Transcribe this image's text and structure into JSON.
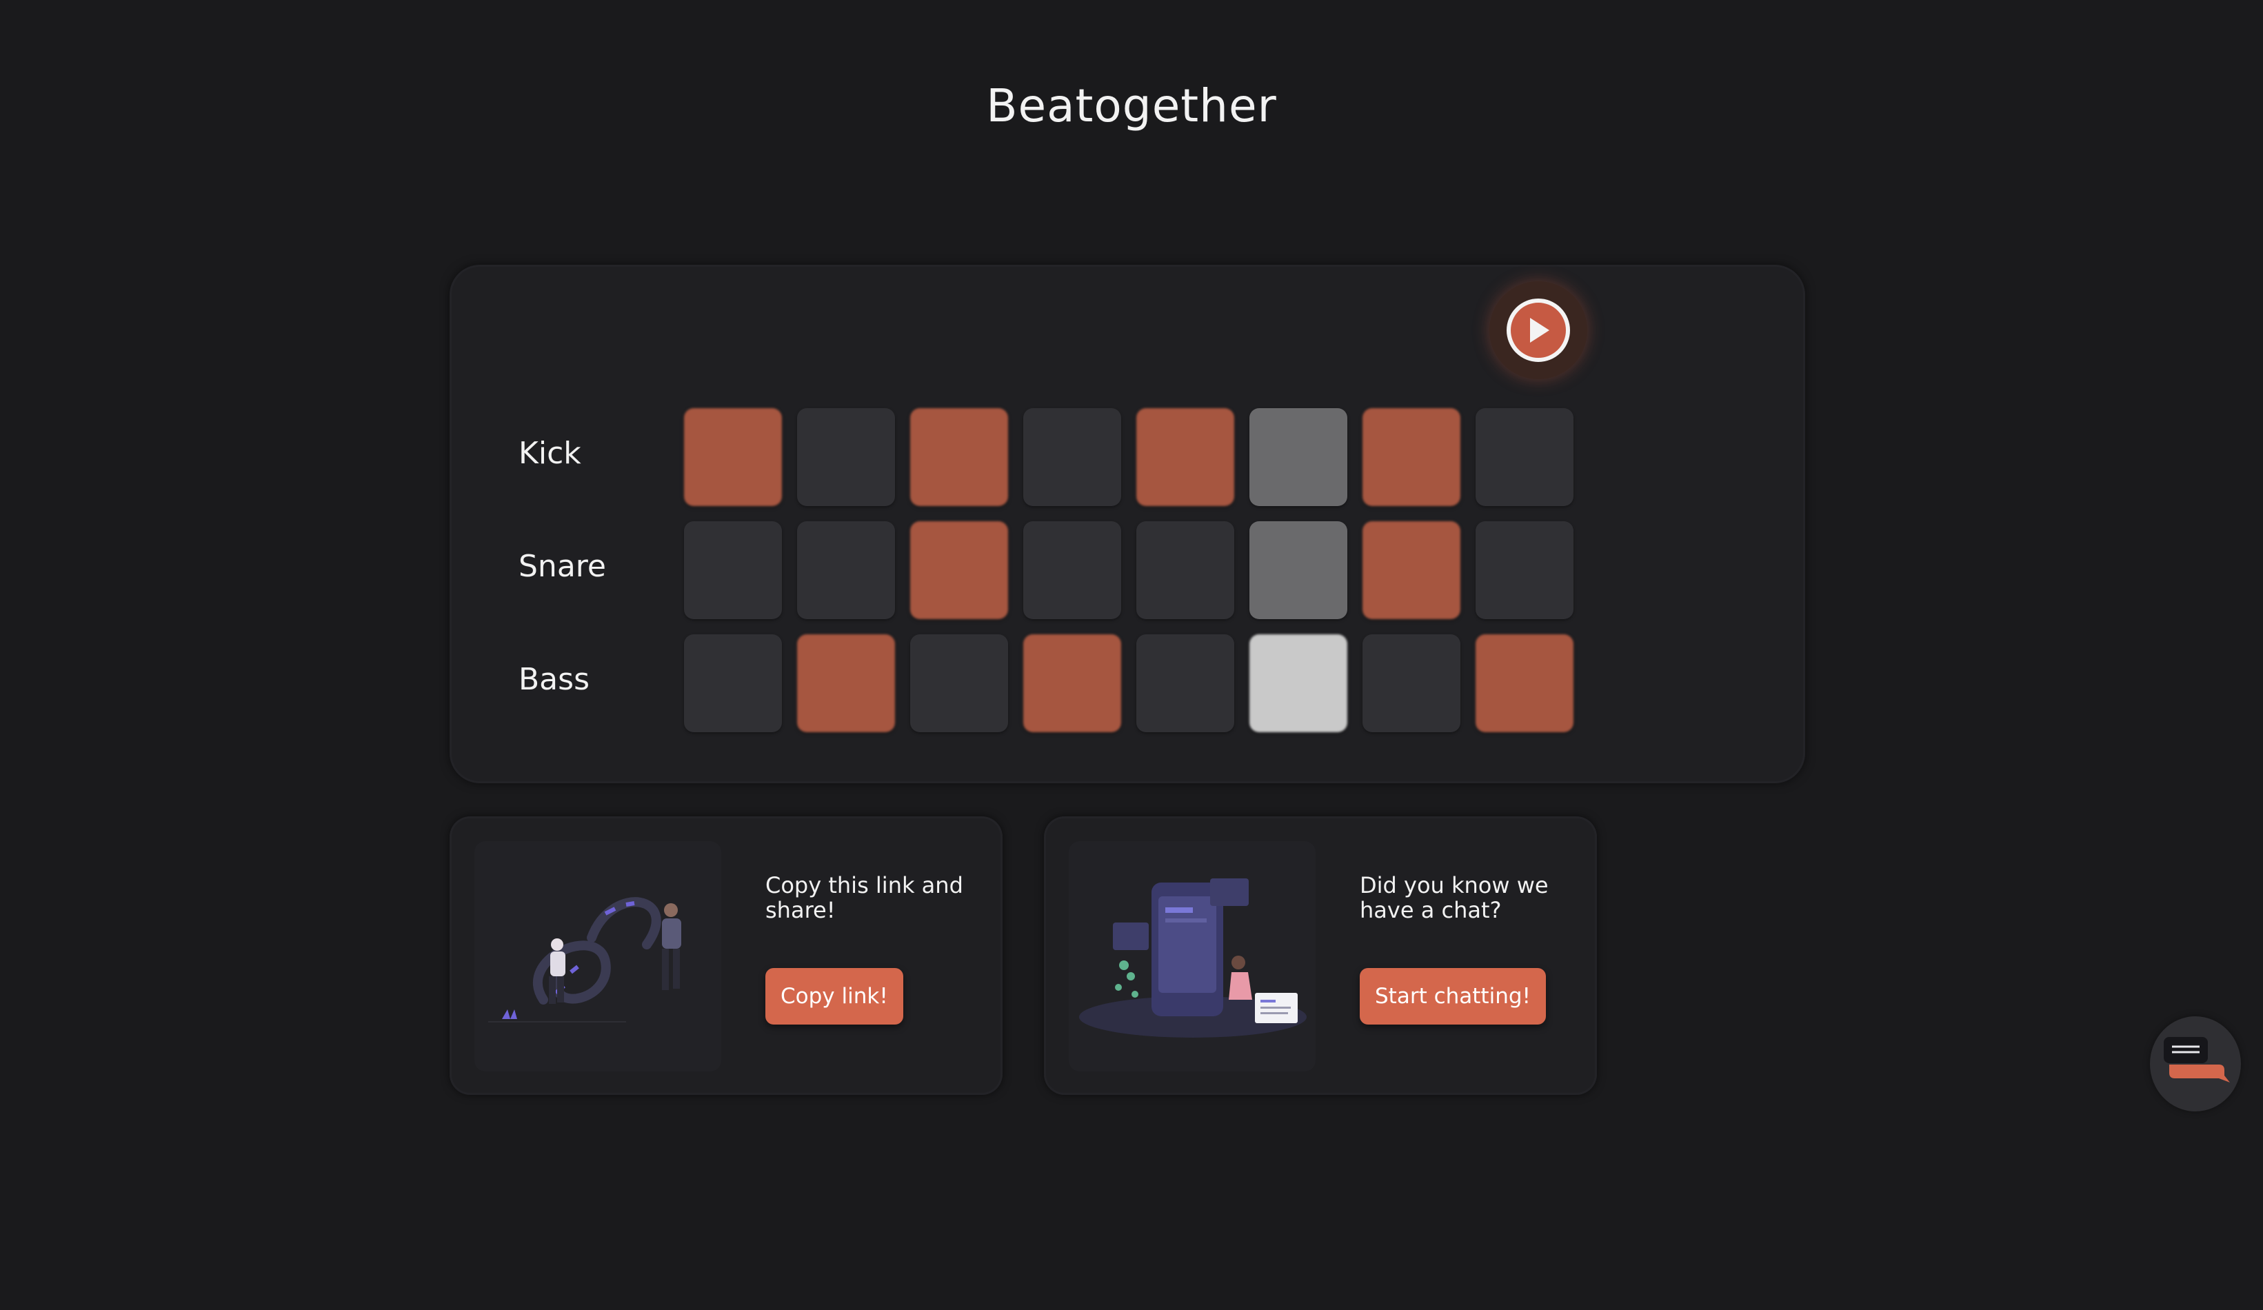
{
  "app": {
    "title": "Beatogether"
  },
  "sequencer": {
    "play_icon": "play-icon",
    "current_step": 6,
    "tracks": [
      {
        "label": "Kick",
        "steps": [
          1,
          0,
          1,
          0,
          1,
          0,
          1,
          0
        ]
      },
      {
        "label": "Snare",
        "steps": [
          0,
          0,
          1,
          0,
          0,
          0,
          1,
          0
        ]
      },
      {
        "label": "Bass",
        "steps": [
          0,
          1,
          0,
          1,
          0,
          1,
          0,
          1
        ]
      }
    ]
  },
  "share_card": {
    "text": "Copy this link and share!",
    "button_label": "Copy link!",
    "illustration": "link-sharing-illustration"
  },
  "chat_card": {
    "text": "Did you know we have a chat?",
    "button_label": "Start chatting!",
    "illustration": "mobile-chat-illustration"
  },
  "chat_fab": {
    "icon": "chat-icon"
  },
  "colors": {
    "background": "#1a1a1c",
    "card": "#1f1f22",
    "accent": "#d4674c",
    "step_on": "#a65640",
    "step_off": "#303034",
    "playhead": "#6a6a6c"
  }
}
